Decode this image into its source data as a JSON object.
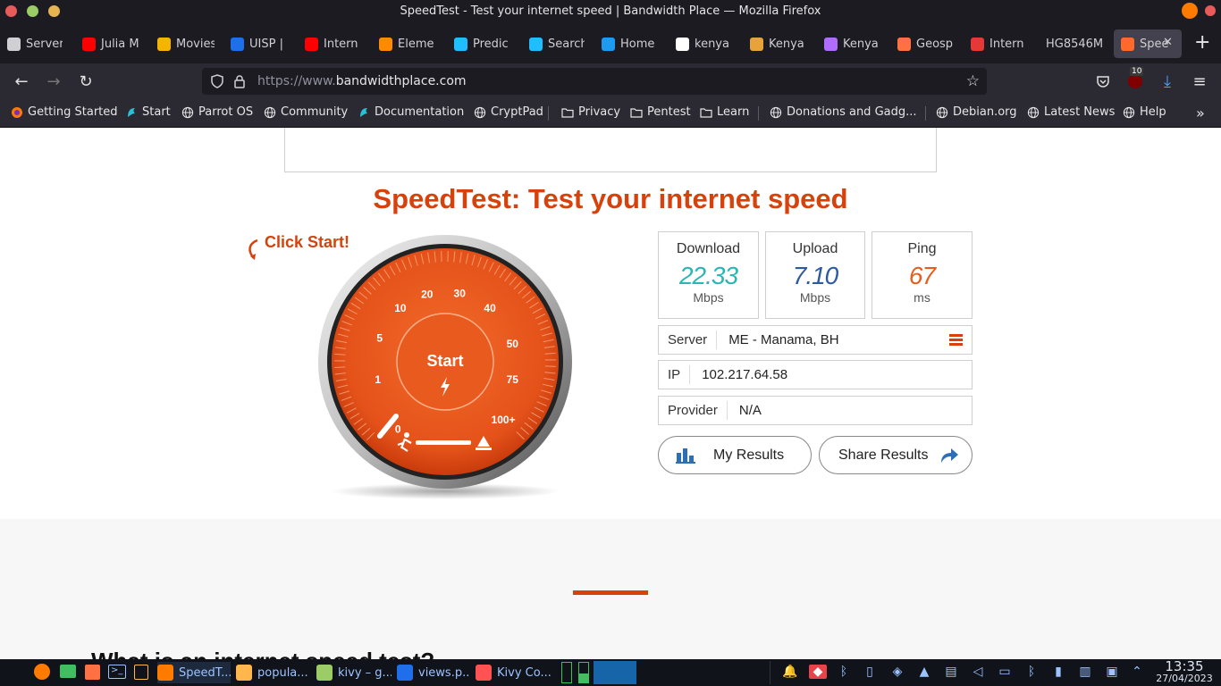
{
  "window": {
    "title": "SpeedTest - Test your internet speed | Bandwidth Place — Mozilla Firefox"
  },
  "tabs": [
    {
      "label": "Server",
      "icon": "info-icon",
      "color": "#cfcfd4"
    },
    {
      "label": "Julia M",
      "icon": "youtube-icon",
      "color": "#ff0000"
    },
    {
      "label": "Movies",
      "icon": "play-icon",
      "color": "#f5b400"
    },
    {
      "label": "UISP |",
      "icon": "uisp-icon",
      "color": "#1f6feb"
    },
    {
      "label": "Intern",
      "icon": "youtube-icon",
      "color": "#ff0000"
    },
    {
      "label": "Eleme",
      "icon": "chart-icon",
      "color": "#ff8a00"
    },
    {
      "label": "Predic",
      "icon": "kaggle-icon",
      "color": "#20beff"
    },
    {
      "label": "Search",
      "icon": "kaggle-icon",
      "color": "#20beff"
    },
    {
      "label": "Home",
      "icon": "twitter-icon",
      "color": "#1d9bf0"
    },
    {
      "label": "kenya",
      "icon": "google-icon",
      "color": "#ffffff"
    },
    {
      "label": "Kenya",
      "icon": "globe-icon",
      "color": "#e8a23a"
    },
    {
      "label": "Kenya",
      "icon": "brand-icon",
      "color": "#b06cff"
    },
    {
      "label": "Geosp",
      "icon": "geo-icon",
      "color": "#ff7043"
    },
    {
      "label": "Intern",
      "icon": "speed-icon",
      "color": "#e53935"
    },
    {
      "label": "HG8546M",
      "icon": "",
      "color": "#cfcfd4"
    },
    {
      "label": "Spee",
      "icon": "speedtest-icon",
      "color": "#ff6a2b",
      "active": true
    }
  ],
  "tab_controls": {
    "close": "✕",
    "new_tab": "+"
  },
  "navbar": {
    "url_prefix": "https://www.",
    "url_domain": "bandwidthplace.com",
    "badge": "10"
  },
  "bookmarks": [
    {
      "label": "Getting Started",
      "icon": "firefox-icon"
    },
    {
      "label": "Start",
      "icon": "parrot-icon"
    },
    {
      "label": "Parrot OS",
      "icon": "globe-icon"
    },
    {
      "label": "Community",
      "icon": "globe-icon"
    },
    {
      "label": "Documentation",
      "icon": "parrot-icon"
    },
    {
      "label": "CryptPad",
      "icon": "globe-icon"
    },
    {
      "label": "Privacy",
      "icon": "folder-icon"
    },
    {
      "label": "Pentest",
      "icon": "folder-icon"
    },
    {
      "label": "Learn",
      "icon": "folder-icon"
    },
    {
      "label": "Donations and Gadg...",
      "icon": "globe-icon"
    },
    {
      "label": "Debian.org",
      "icon": "globe-icon"
    },
    {
      "label": "Latest News",
      "icon": "globe-icon"
    },
    {
      "label": "Help",
      "icon": "globe-icon"
    }
  ],
  "page": {
    "heading": "SpeedTest: Test your internet speed",
    "click_start": "Click Start!",
    "start_label": "Start",
    "dial_labels": [
      "0",
      "1",
      "5",
      "10",
      "20",
      "30",
      "40",
      "50",
      "75",
      "100+"
    ],
    "download": {
      "label": "Download",
      "value": "22.33",
      "unit": "Mbps",
      "color": "#2bb5b5"
    },
    "upload": {
      "label": "Upload",
      "value": "7.10",
      "unit": "Mbps",
      "color": "#2d5aa0"
    },
    "ping": {
      "label": "Ping",
      "value": "67",
      "unit": "ms",
      "color": "#e2601f"
    },
    "server": {
      "label": "Server",
      "value": "ME - Manama, BH"
    },
    "ip": {
      "label": "IP",
      "value": "102.217.64.58"
    },
    "provider": {
      "label": "Provider",
      "value": "N/A"
    },
    "my_results": "My Results",
    "share_results": "Share Results",
    "next_heading": "What is an internet speed test?",
    "accent": "#d6410c"
  },
  "taskbar": {
    "tasks": [
      "SpeedT...",
      "popula...",
      "kivy – g...",
      "views.p...",
      "Kivy Co..."
    ],
    "time": "13:35",
    "date": "27/04/2023"
  }
}
